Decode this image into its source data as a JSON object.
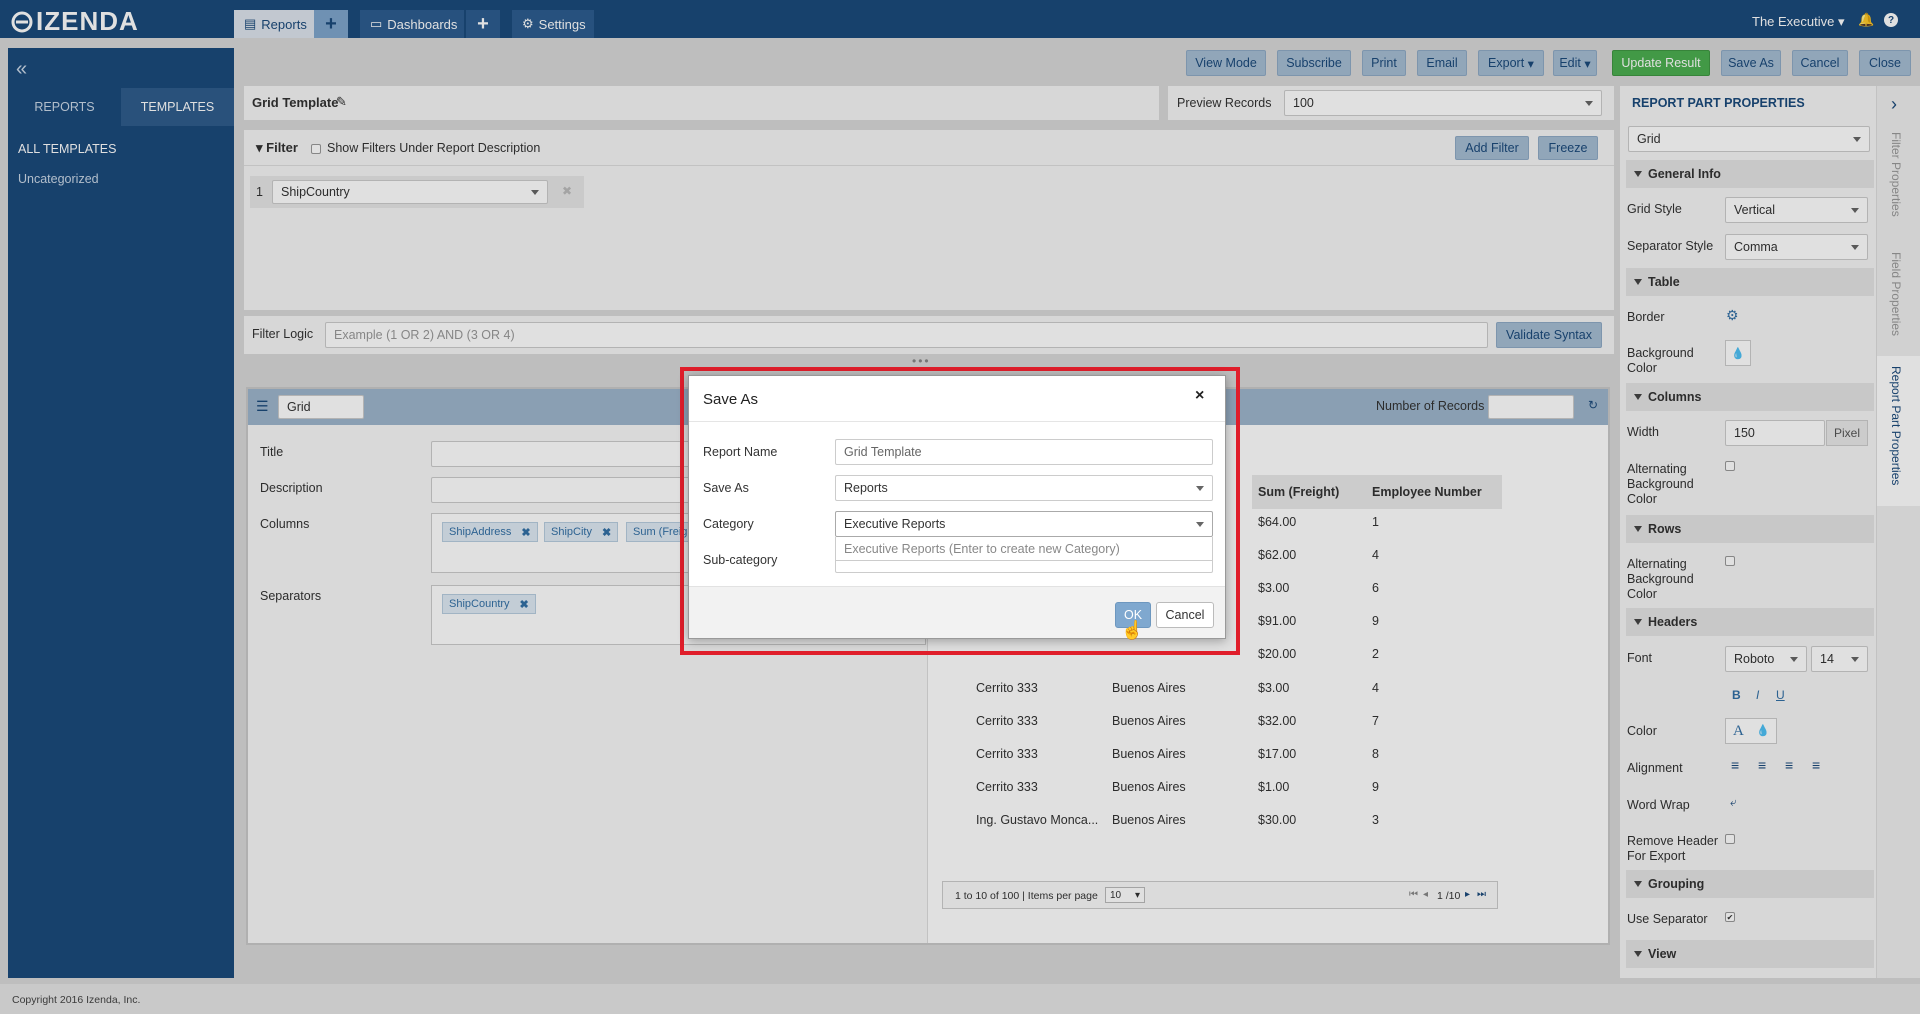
{
  "topnav": {
    "logo": "IZENDA",
    "tabs": [
      {
        "label": "Reports"
      },
      {
        "label": "Dashboards"
      },
      {
        "label": "Settings"
      }
    ],
    "user": "The Executive"
  },
  "toolbar": {
    "buttons": [
      "View Mode",
      "Subscribe",
      "Print",
      "Email",
      "Export",
      "Edit",
      "Update Result",
      "Save As",
      "Cancel",
      "Close"
    ]
  },
  "left_panel": {
    "tabs": [
      "REPORTS",
      "TEMPLATES"
    ],
    "items": [
      "ALL TEMPLATES",
      "Uncategorized"
    ]
  },
  "report": {
    "title": "Grid Template",
    "preview_label": "Preview Records",
    "preview_value": "100",
    "filter_label": "Filter",
    "show_filters_label": "Show Filters Under Report Description",
    "add_filter": "Add Filter",
    "freeze": "Freeze",
    "filter_index": "1",
    "filter_field": "ShipCountry",
    "filter_logic_label": "Filter Logic",
    "filter_logic_placeholder": "Example (1 OR 2) AND (3 OR 4)",
    "validate_syntax": "Validate Syntax"
  },
  "part": {
    "type": "Grid",
    "number_of_records_label": "Number of Records",
    "labels": [
      "Title",
      "Description",
      "Columns",
      "Separators"
    ],
    "column_chips": [
      "ShipAddress",
      "ShipCity",
      "Sum (Freigh"
    ],
    "separator_chips": [
      "ShipCountry"
    ],
    "grid_headers": [
      "Sum (Freight)",
      "Employee Number"
    ],
    "top_rows": [
      {
        "sum": "$64.00",
        "emp": "1"
      },
      {
        "sum": "$62.00",
        "emp": "4"
      },
      {
        "sum": "$3.00",
        "emp": "6"
      },
      {
        "sum": "$91.00",
        "emp": "9"
      },
      {
        "sum": "$20.00",
        "emp": "2"
      }
    ],
    "rows": [
      {
        "addr": "Cerrito 333",
        "city": "Buenos Aires",
        "sum": "$3.00",
        "emp": "4"
      },
      {
        "addr": "Cerrito 333",
        "city": "Buenos Aires",
        "sum": "$32.00",
        "emp": "7"
      },
      {
        "addr": "Cerrito 333",
        "city": "Buenos Aires",
        "sum": "$17.00",
        "emp": "8"
      },
      {
        "addr": "Cerrito 333",
        "city": "Buenos Aires",
        "sum": "$1.00",
        "emp": "9"
      },
      {
        "addr": "Ing. Gustavo Monca...",
        "city": "Buenos Aires",
        "sum": "$30.00",
        "emp": "3"
      }
    ],
    "pager_text": "1 to 10 of 100 | Items per page",
    "items_per_page": "10",
    "page_indicator": "1 /10"
  },
  "properties": {
    "header": "REPORT PART PROPERTIES",
    "type": "Grid",
    "general_info": "General Info",
    "grid_style_label": "Grid Style",
    "grid_style": "Vertical",
    "separator_style_label": "Separator Style",
    "separator_style": "Comma",
    "table": "Table",
    "border_label": "Border",
    "background_color_label": "Background Color",
    "columns": "Columns",
    "width_label": "Width",
    "width_value": "150",
    "width_unit": "Pixel",
    "alt_bg_label": "Alternating Background Color",
    "rows": "Rows",
    "alt_bg_rows_label": "Alternating Background Color",
    "headers": "Headers",
    "font_label": "Font",
    "font_value": "Roboto",
    "font_size": "14",
    "color_label": "Color",
    "alignment_label": "Alignment",
    "word_wrap_label": "Word Wrap",
    "remove_header_label": "Remove Header For Export",
    "grouping": "Grouping",
    "use_separator_label": "Use Separator",
    "view": "View",
    "side_tabs": [
      "Filter Properties",
      "Field Properties",
      "Report Part Properties"
    ]
  },
  "modal": {
    "title": "Save As",
    "report_name_label": "Report Name",
    "report_name_value": "Grid Template",
    "save_as_label": "Save As",
    "save_as_value": "Reports",
    "category_label": "Category",
    "category_value": "Executive Reports",
    "category_hint": "Executive Reports (Enter to create new Category)",
    "subcategory_label": "Sub-category",
    "ok": "OK",
    "cancel": "Cancel"
  },
  "footer": "Copyright 2016 Izenda, Inc.",
  "colors": {
    "nav": "#1b4a7c",
    "accent": "#a6bdd3",
    "green": "#4caf50",
    "highlight": "#e01e2b"
  }
}
